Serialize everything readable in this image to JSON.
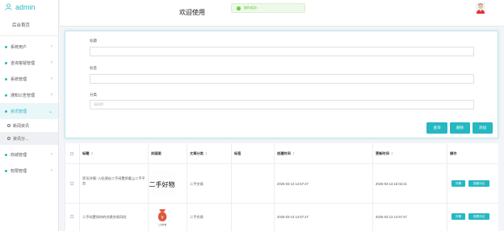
{
  "brand": {
    "name": "admin"
  },
  "sidebar": {
    "home": "后台首页",
    "items": [
      {
        "label": "系统用户"
      },
      {
        "label": "咨询答疑管理"
      },
      {
        "label": "系统管理"
      },
      {
        "label": "通知公告管理"
      },
      {
        "label": "资讯管理"
      },
      {
        "label": "商城管理"
      },
      {
        "label": "权限管理"
      }
    ],
    "sub_items": [
      {
        "label": "新闻资讯"
      },
      {
        "label": "资讯分..."
      }
    ]
  },
  "topbar": {
    "welcome": "欢迎使用",
    "toast": "操作成功!"
  },
  "search": {
    "title_label": "标题",
    "tag_label": "标签",
    "category_label": "分类",
    "category_placeholder": "请选择"
  },
  "buttons": {
    "search": "查询",
    "delete": "删除",
    "add": "添加"
  },
  "table": {
    "columns": [
      "标题",
      "封面图",
      "文章分类",
      "标签",
      "创建时间",
      "更新时间",
      "操作"
    ],
    "rows": [
      {
        "title": "资讯详情: 入驻源自二手闲置质量上二手平台",
        "cover_text": "二手好物",
        "category": "二手交易",
        "tag": "",
        "created": "2025-03-13 14:57:47",
        "updated": "2025-03-13 15:02:21",
        "action_detail": "详情",
        "action_comments": "查看评论"
      },
      {
        "title": "二手闲置如何的交换交易风险",
        "cover_text": "二手好物",
        "category": "二手交易",
        "tag": "",
        "created": "2025-03-13 14:57:47",
        "updated": "2025-03-13 14:57:47",
        "action_detail": "详情",
        "action_comments": "查看评论"
      }
    ]
  },
  "colors": {
    "accent": "#26b8c2",
    "success": "#67c23a"
  }
}
